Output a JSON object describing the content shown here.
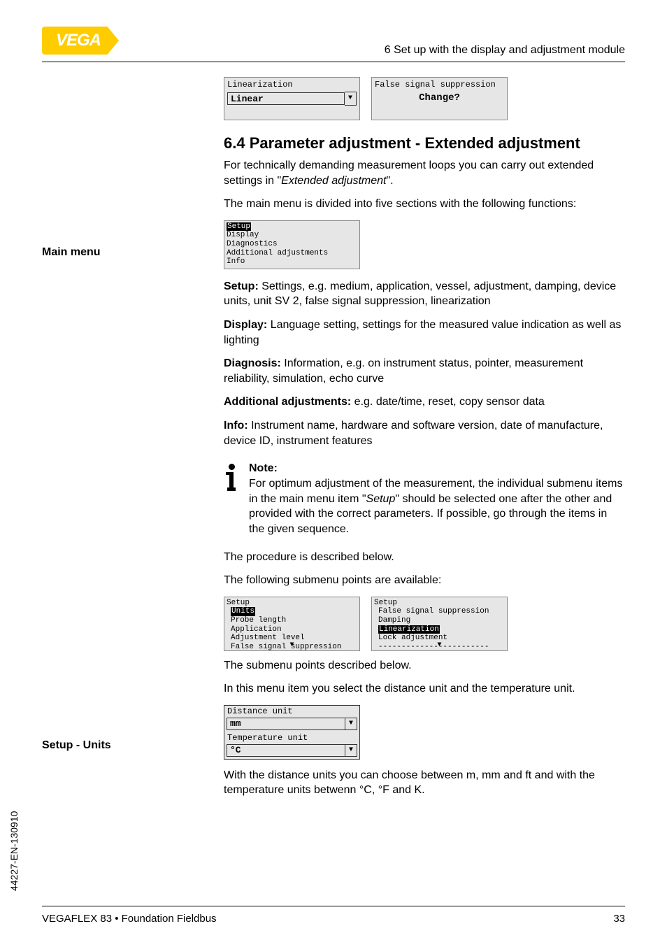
{
  "logo_text": "VEGA",
  "header_right": "6 Set up with the display and adjustment module",
  "lcd_top_left": {
    "title": "Linearization",
    "value": "Linear"
  },
  "lcd_top_right": {
    "title": "False signal suppression",
    "prompt": "Change?"
  },
  "section_title": "6.4    Parameter adjustment - Extended adjustment",
  "sec_intro_1": "For technically demanding measurement loops you can carry out extended settings in \"",
  "sec_intro_italic": "Extended adjustment",
  "sec_intro_2": "\".",
  "main_menu_label": "Main menu",
  "main_menu_text": "The main menu is divided into five sections with the following functions:",
  "lcd_menu": {
    "hilite": "Setup",
    "l2": "Display",
    "l3": "Diagnostics",
    "l4": "Additional adjustments",
    "l5": "Info"
  },
  "setup_bold": "Setup:",
  "setup_text": " Settings, e.g. medium, application, vessel, adjustment, damping, device units, unit SV 2, false signal suppression, linearization",
  "display_bold": "Display:",
  "display_text": " Language setting, settings for the measured value indication as well as lighting",
  "diag_bold": "Diagnosis:",
  "diag_text": " Information, e.g. on instrument status, pointer, measurement reliability, simulation, echo curve",
  "addadj_bold": "Additional adjustments:",
  "addadj_text": " e.g. date/time, reset, copy sensor data",
  "info_bold": "Info:",
  "info_text": " Instrument name, hardware and software version, date of manufacture, device ID, instrument features",
  "note_label": "Note:",
  "note_text_1": "For optimum adjustment of the measurement, the individual submenu items in the main menu item \"",
  "note_text_italic": "Setup",
  "note_text_2": "\" should be selected one after the other and provided with the correct parameters. If possible, go through the items in the given sequence.",
  "proc_text": "The procedure is described below.",
  "subm_text": "The following submenu points are available:",
  "lcd_setup_a": {
    "t": "Setup",
    "hilite": "Units",
    "l2": "Probe length",
    "l3": "Application",
    "l4": "Adjustment level",
    "l5": "False signal suppression"
  },
  "lcd_setup_b": {
    "t": "Setup",
    "l1": "False signal suppression",
    "l2": "Damping",
    "hilite": "Linearization",
    "l4": "Lock adjustment",
    "l5": "------------------------"
  },
  "subm_below": "The submenu points described below.",
  "setup_units_label": "Setup - Units",
  "setup_units_text": "In this menu item you select the distance unit and the temperature unit.",
  "unit_dist_label": "Distance unit",
  "unit_dist_val": "mm",
  "unit_temp_label": "Temperature unit",
  "unit_temp_val": "°C",
  "unit_after": "With the distance units you can choose between m, mm and ft and with the temperature units betwenn °C, °F and K.",
  "side_text": "44227-EN-130910",
  "footer_left": "VEGAFLEX 83 • Foundation Fieldbus",
  "footer_right": "33"
}
